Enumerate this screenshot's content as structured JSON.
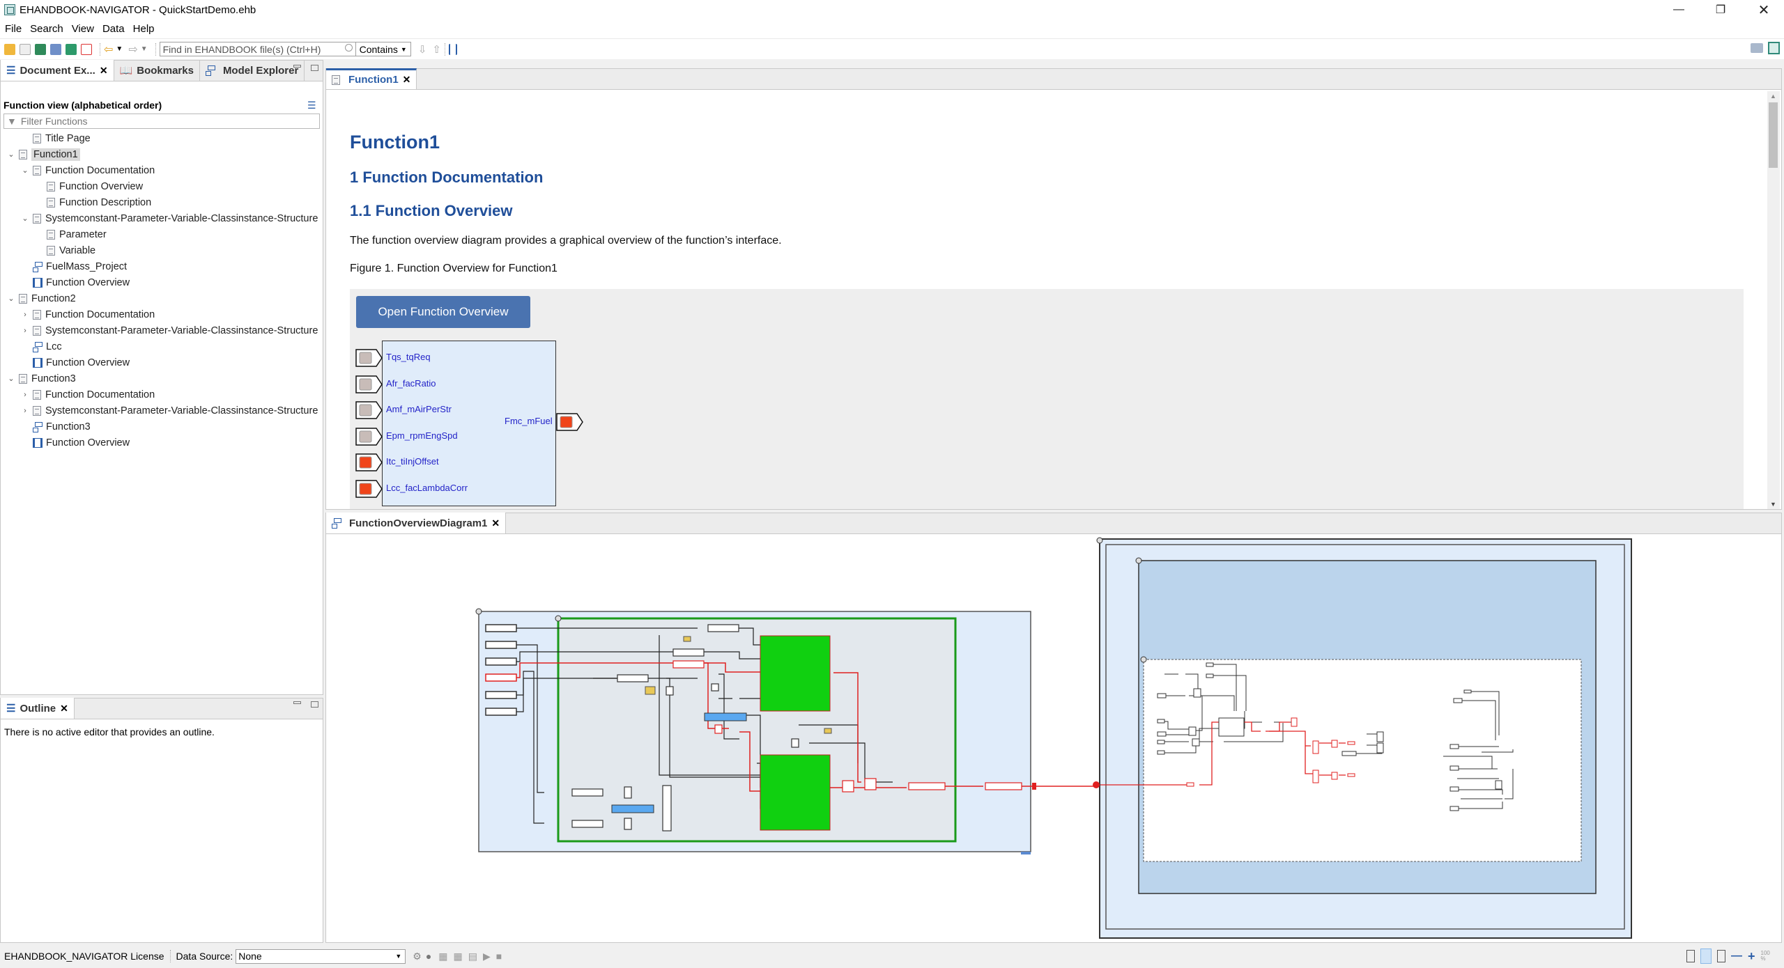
{
  "window": {
    "title": "EHANDBOOK-NAVIGATOR - QuickStartDemo.ehb",
    "minimize_icon": "minimize-icon",
    "restore_icon": "restore-icon",
    "close_icon": "close-icon"
  },
  "menu": [
    "File",
    "Search",
    "View",
    "Data",
    "Help"
  ],
  "toolbar": {
    "icons": [
      "open-folder-icon",
      "save-icon",
      "book-icon",
      "print-icon",
      "export-icon",
      "pdf-icon",
      "back-icon",
      "forward-icon"
    ],
    "search_placeholder": "Find in EHANDBOOK file(s) (Ctrl+H)",
    "search_mode": "Contains",
    "right_icons": [
      "keyboard-icon",
      "ehandbook-perspective-icon"
    ]
  },
  "left_panel": {
    "tabs": [
      {
        "label": "Document Ex...",
        "active": true,
        "closable": true
      },
      {
        "label": "Bookmarks",
        "active": false
      },
      {
        "label": "Model Explorer",
        "active": false
      }
    ],
    "header": "Function view (alphabetical order)",
    "filter_placeholder": "Filter Functions",
    "tree": [
      {
        "label": "Title Page",
        "level": 1,
        "icon": "doc",
        "twisty": ""
      },
      {
        "label": "Function1",
        "level": 0,
        "icon": "doc",
        "twisty": "v",
        "selected": true
      },
      {
        "label": "Function Documentation",
        "level": 1,
        "icon": "doc",
        "twisty": "v"
      },
      {
        "label": "Function Overview",
        "level": 2,
        "icon": "doc",
        "twisty": ""
      },
      {
        "label": "Function Description",
        "level": 2,
        "icon": "doc",
        "twisty": ""
      },
      {
        "label": "Systemconstant-Parameter-Variable-Classinstance-Structure",
        "level": 1,
        "icon": "doc",
        "twisty": "v"
      },
      {
        "label": "Parameter",
        "level": 2,
        "icon": "doc",
        "twisty": ""
      },
      {
        "label": "Variable",
        "level": 2,
        "icon": "doc",
        "twisty": ""
      },
      {
        "label": "FuelMass_Project",
        "level": 1,
        "icon": "model",
        "twisty": ""
      },
      {
        "label": "Function Overview",
        "level": 1,
        "icon": "overview",
        "twisty": ""
      },
      {
        "label": "Function2",
        "level": 0,
        "icon": "doc",
        "twisty": "v"
      },
      {
        "label": "Function Documentation",
        "level": 1,
        "icon": "doc",
        "twisty": ">"
      },
      {
        "label": "Systemconstant-Parameter-Variable-Classinstance-Structure",
        "level": 1,
        "icon": "doc",
        "twisty": ">"
      },
      {
        "label": "Lcc",
        "level": 1,
        "icon": "model",
        "twisty": ""
      },
      {
        "label": "Function Overview",
        "level": 1,
        "icon": "overview",
        "twisty": ""
      },
      {
        "label": "Function3",
        "level": 0,
        "icon": "doc",
        "twisty": "v"
      },
      {
        "label": "Function Documentation",
        "level": 1,
        "icon": "doc",
        "twisty": ">"
      },
      {
        "label": "Systemconstant-Parameter-Variable-Classinstance-Structure",
        "level": 1,
        "icon": "doc",
        "twisty": ">"
      },
      {
        "label": "Function3",
        "level": 1,
        "icon": "model",
        "twisty": ""
      },
      {
        "label": "Function Overview",
        "level": 1,
        "icon": "overview",
        "twisty": ""
      }
    ]
  },
  "outline_panel": {
    "tab": "Outline",
    "message": "There is no active editor that provides an outline."
  },
  "editor": {
    "tab": "Function1",
    "title": "Function1",
    "h2": "1 Function Documentation",
    "h3": "1.1 Function Overview",
    "paragraph": "The function overview diagram provides a graphical overview of the function’s interface.",
    "figure_caption": "Figure 1. Function Overview for Function1",
    "open_button": "Open Function Overview",
    "inputs": [
      {
        "name": "Tqs_tqReq",
        "color": "#c8bcb8"
      },
      {
        "name": "Afr_facRatio",
        "color": "#c8bcb8"
      },
      {
        "name": "Amf_mAirPerStr",
        "color": "#c8bcb8"
      },
      {
        "name": "Epm_rpmEngSpd",
        "color": "#c8bcb8"
      },
      {
        "name": "Itc_tiInjOffset",
        "color": "#f0441a"
      },
      {
        "name": "Lcc_facLambdaCorr",
        "color": "#f0441a"
      }
    ],
    "output": {
      "name": "Fmc_mFuel",
      "color": "#f0441a"
    }
  },
  "diagram": {
    "tab": "FunctionOverviewDiagram1"
  },
  "statusbar": {
    "license": "EHANDBOOK_NAVIGATOR License",
    "data_source_label": "Data Source:",
    "data_source_value": "None",
    "icons": [
      "settings-icon",
      "database-icon",
      "calibration-icon",
      "calibration-remove-icon",
      "hierarchy-icon",
      "play-icon",
      "stop-icon"
    ],
    "right_icons": [
      "page-view-icon",
      "split-view-icon",
      "diagram-view-icon",
      "zoom-out-icon",
      "zoom-in-icon",
      "zoom-100-icon"
    ],
    "zoom_100": "100 %"
  }
}
